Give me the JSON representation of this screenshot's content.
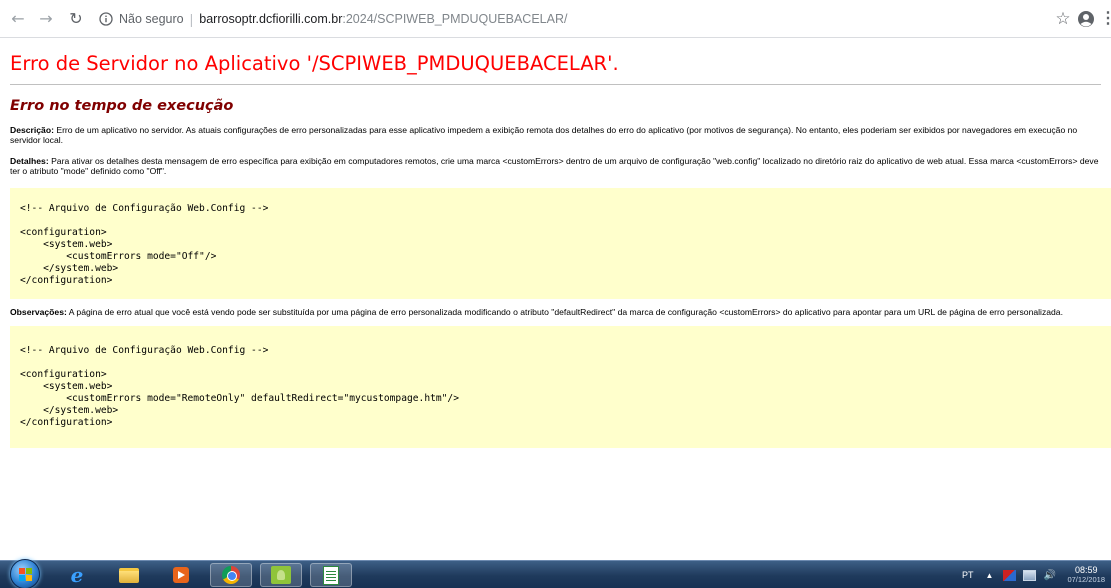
{
  "browser": {
    "security_label": "Não seguro",
    "url_host": "barrosoptr.dcfiorilli.com.br",
    "url_path": ":2024/SCPIWEB_PMDUQUEBACELAR/",
    "icons": {
      "back": "back-arrow-icon",
      "forward": "forward-arrow-icon",
      "reload": "reload-icon",
      "info": "info-icon",
      "star": "star-icon",
      "account": "account-icon",
      "menu": "menu-icon"
    }
  },
  "page": {
    "title": "Erro de Servidor no Aplicativo '/SCPIWEB_PMDUQUEBACELAR'.",
    "subtitle": "Erro no tempo de execução",
    "description": {
      "label": "Descrição:",
      "text": " Erro de um aplicativo no servidor. As atuais configurações de erro personalizadas para esse aplicativo impedem a exibição remota dos detalhes do erro do aplicativo (por motivos de segurança). No entanto, eles poderiam ser exibidos por navegadores em execução no servidor local."
    },
    "details": {
      "label": "Detalhes:",
      "text": " Para ativar os detalhes desta mensagem de erro específica para exibição em computadores remotos, crie uma marca <customErrors> dentro de um arquivo de configuração \"web.config\" localizado no diretório raiz do aplicativo de web atual. Essa marca <customErrors> deve ter o atributo \"mode\" definido como \"Off\"."
    },
    "code_block_1": "<!-- Arquivo de Configuração Web.Config -->\n\n<configuration>\n    <system.web>\n        <customErrors mode=\"Off\"/>\n    </system.web>\n</configuration>",
    "observations": {
      "label": "Observações:",
      "text": " A página de erro atual que você está vendo pode ser substituída por uma página de erro personalizada modificando o atributo \"defaultRedirect\" da marca de configuração <customErrors> do aplicativo para apontar para um URL de página de erro personalizada."
    },
    "code_block_2": "<!-- Arquivo de Configuração Web.Config -->\n\n<configuration>\n    <system.web>\n        <customErrors mode=\"RemoteOnly\" defaultRedirect=\"mycustompage.htm\"/>\n    </system.web>\n</configuration>"
  },
  "taskbar": {
    "apps": [
      "internet-explorer-icon",
      "file-explorer-icon",
      "media-player-icon",
      "chrome-icon",
      "app-icon",
      "spreadsheet-icon"
    ],
    "active_app": "chrome-icon",
    "language": "PT",
    "time": "08:59",
    "date": "07/12/2018"
  },
  "colors": {
    "title_red": "#ff0000",
    "subtitle_maroon": "#800000",
    "code_background": "#ffffcc"
  }
}
